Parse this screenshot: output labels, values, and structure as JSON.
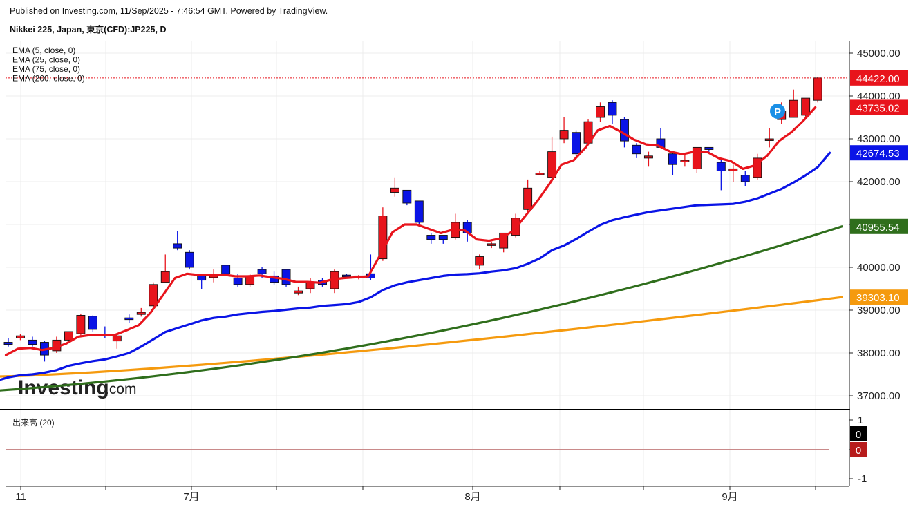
{
  "header": {
    "published": "Published on Investing.com, 11/Sep/2025 - 7:46:54 GMT, Powered by TradingView.",
    "instrument": "Nikkei 225, Japan, 東京(CFD):JP225, D"
  },
  "legend": [
    "EMA (5, close, 0)",
    "EMA (25, close, 0)",
    "EMA (75, close, 0)",
    "EMA (200, close, 0)"
  ],
  "watermark": {
    "brand": "Investing",
    "suffix": ".com"
  },
  "volume": {
    "label": "出来高 (20)",
    "ticks": [
      "1",
      "0",
      "-1"
    ],
    "badges": [
      "0",
      "0"
    ]
  },
  "marker": "P",
  "colors": {
    "up": "#e8141c",
    "down": "#0a14e6",
    "ema5": "#e8141c",
    "ema25": "#0a14e6",
    "ema75": "#2f6e1c",
    "ema200": "#f59a0e",
    "current": "#e8141c",
    "grid": "#ececec"
  },
  "chart_data": {
    "type": "candlestick",
    "y_ticks": [
      "45000.00",
      "44000.00",
      "43000.00",
      "42000.00",
      "41000.00",
      "40000.00",
      "39000.00",
      "38000.00",
      "37000.00"
    ],
    "ylim": [
      36800,
      45300
    ],
    "x_ticks": [
      "11",
      "7月",
      "8月",
      "9月"
    ],
    "price_badges": [
      {
        "label": "44422.00",
        "value": 44422,
        "color": "#e8141c"
      },
      {
        "label": "43735.02",
        "value": 43735,
        "color": "#e8141c"
      },
      {
        "label": "42674.53",
        "value": 42674,
        "color": "#0a14e6"
      },
      {
        "label": "40955.54",
        "value": 40955,
        "color": "#2f6e1c"
      },
      {
        "label": "39303.10",
        "value": 39303,
        "color": "#f59a0e"
      }
    ],
    "candles": [
      [
        38250,
        38350,
        38150,
        38200
      ],
      [
        38350,
        38450,
        38300,
        38400
      ],
      [
        38300,
        38380,
        38150,
        38200
      ],
      [
        38250,
        38280,
        37800,
        37950
      ],
      [
        38050,
        38380,
        38000,
        38300
      ],
      [
        38300,
        38500,
        38250,
        38500
      ],
      [
        38450,
        38920,
        38400,
        38880
      ],
      [
        38860,
        38880,
        38500,
        38550
      ],
      [
        38440,
        38620,
        38350,
        38400
      ],
      [
        38280,
        38450,
        38100,
        38400
      ],
      [
        38820,
        38900,
        38700,
        38800
      ],
      [
        38900,
        39050,
        38850,
        38950
      ],
      [
        39100,
        39650,
        39080,
        39600
      ],
      [
        39650,
        40300,
        39650,
        39900
      ],
      [
        40550,
        40850,
        40400,
        40450
      ],
      [
        40350,
        40400,
        39950,
        40000
      ],
      [
        39800,
        39850,
        39500,
        39700
      ],
      [
        39800,
        39950,
        39650,
        39800
      ],
      [
        40050,
        40050,
        39800,
        39850
      ],
      [
        39750,
        39850,
        39550,
        39600
      ],
      [
        39600,
        39850,
        39550,
        39800
      ],
      [
        39950,
        40000,
        39750,
        39850
      ],
      [
        39800,
        39900,
        39600,
        39650
      ],
      [
        39950,
        39950,
        39550,
        39600
      ],
      [
        39400,
        39550,
        39350,
        39450
      ],
      [
        39500,
        39750,
        39400,
        39650
      ],
      [
        39700,
        39750,
        39550,
        39600
      ],
      [
        39500,
        39950,
        39400,
        39900
      ],
      [
        39820,
        39850,
        39750,
        39800
      ],
      [
        39750,
        39820,
        39720,
        39800
      ],
      [
        39850,
        40300,
        39700,
        39750
      ],
      [
        40200,
        41400,
        40150,
        41200
      ],
      [
        41750,
        42100,
        41650,
        41850
      ],
      [
        41800,
        41800,
        41450,
        41500
      ],
      [
        41550,
        41550,
        40950,
        41050
      ],
      [
        40750,
        40800,
        40550,
        40650
      ],
      [
        40750,
        40750,
        40550,
        40650
      ],
      [
        40700,
        41250,
        40650,
        41050
      ],
      [
        41050,
        41100,
        40600,
        40800
      ],
      [
        40050,
        40300,
        39950,
        40250
      ],
      [
        40550,
        40600,
        40450,
        40550
      ],
      [
        40450,
        40800,
        40350,
        40800
      ],
      [
        40750,
        41250,
        40700,
        41150
      ],
      [
        41350,
        42050,
        41300,
        41850
      ],
      [
        42200,
        42250,
        42150,
        42200
      ],
      [
        42100,
        43050,
        42000,
        42700
      ],
      [
        43000,
        43500,
        42900,
        43200
      ],
      [
        43150,
        43200,
        42600,
        42650
      ],
      [
        42900,
        43450,
        42850,
        43400
      ],
      [
        43500,
        43850,
        43400,
        43750
      ],
      [
        43850,
        43900,
        43350,
        43550
      ],
      [
        43450,
        43500,
        42800,
        42950
      ],
      [
        42850,
        42900,
        42550,
        42650
      ],
      [
        42550,
        42700,
        42350,
        42600
      ],
      [
        43000,
        43250,
        42800,
        42800
      ],
      [
        42650,
        42700,
        42150,
        42400
      ],
      [
        42500,
        42650,
        42350,
        42500
      ],
      [
        42300,
        42800,
        42200,
        42800
      ],
      [
        42800,
        42800,
        42700,
        42750
      ],
      [
        42450,
        42550,
        41800,
        42250
      ],
      [
        42250,
        42400,
        42000,
        42300
      ],
      [
        42150,
        42250,
        41900,
        42000
      ],
      [
        42100,
        42650,
        42050,
        42550
      ],
      [
        43000,
        43250,
        42800,
        43000
      ],
      [
        43450,
        43850,
        43350,
        43650
      ],
      [
        43500,
        44150,
        43500,
        43900
      ],
      [
        43550,
        43950,
        43500,
        43950
      ],
      [
        43900,
        44450,
        43850,
        44422
      ]
    ],
    "ema5": [
      37950,
      38100,
      38120,
      38070,
      38120,
      38220,
      38380,
      38420,
      38420,
      38420,
      38530,
      38650,
      38950,
      39350,
      39750,
      39850,
      39820,
      39820,
      39830,
      39790,
      39790,
      39810,
      39770,
      39730,
      39660,
      39660,
      39640,
      39720,
      39750,
      39770,
      39790,
      40300,
      40820,
      41000,
      41000,
      40900,
      40800,
      40880,
      40860,
      40650,
      40620,
      40680,
      40850,
      41200,
      41550,
      41950,
      42400,
      42500,
      42800,
      43200,
      43300,
      43150,
      42980,
      42870,
      42840,
      42700,
      42640,
      42700,
      42700,
      42550,
      42480,
      42300,
      42380,
      42600,
      42950,
      43150,
      43420,
      43735
    ],
    "ema25": [
      37350,
      37430,
      37480,
      37500,
      37540,
      37600,
      37700,
      37760,
      37810,
      37850,
      37920,
      38000,
      38150,
      38320,
      38490,
      38580,
      38670,
      38760,
      38820,
      38850,
      38900,
      38930,
      38960,
      38980,
      39010,
      39040,
      39060,
      39100,
      39120,
      39140,
      39190,
      39300,
      39470,
      39580,
      39650,
      39700,
      39750,
      39800,
      39830,
      39840,
      39860,
      39900,
      39930,
      39980,
      40080,
      40210,
      40400,
      40510,
      40660,
      40830,
      40990,
      41100,
      41170,
      41230,
      41290,
      41330,
      41370,
      41410,
      41450,
      41460,
      41470,
      41480,
      41530,
      41610,
      41720,
      41830,
      41980,
      42150,
      42340,
      42674
    ]
  }
}
